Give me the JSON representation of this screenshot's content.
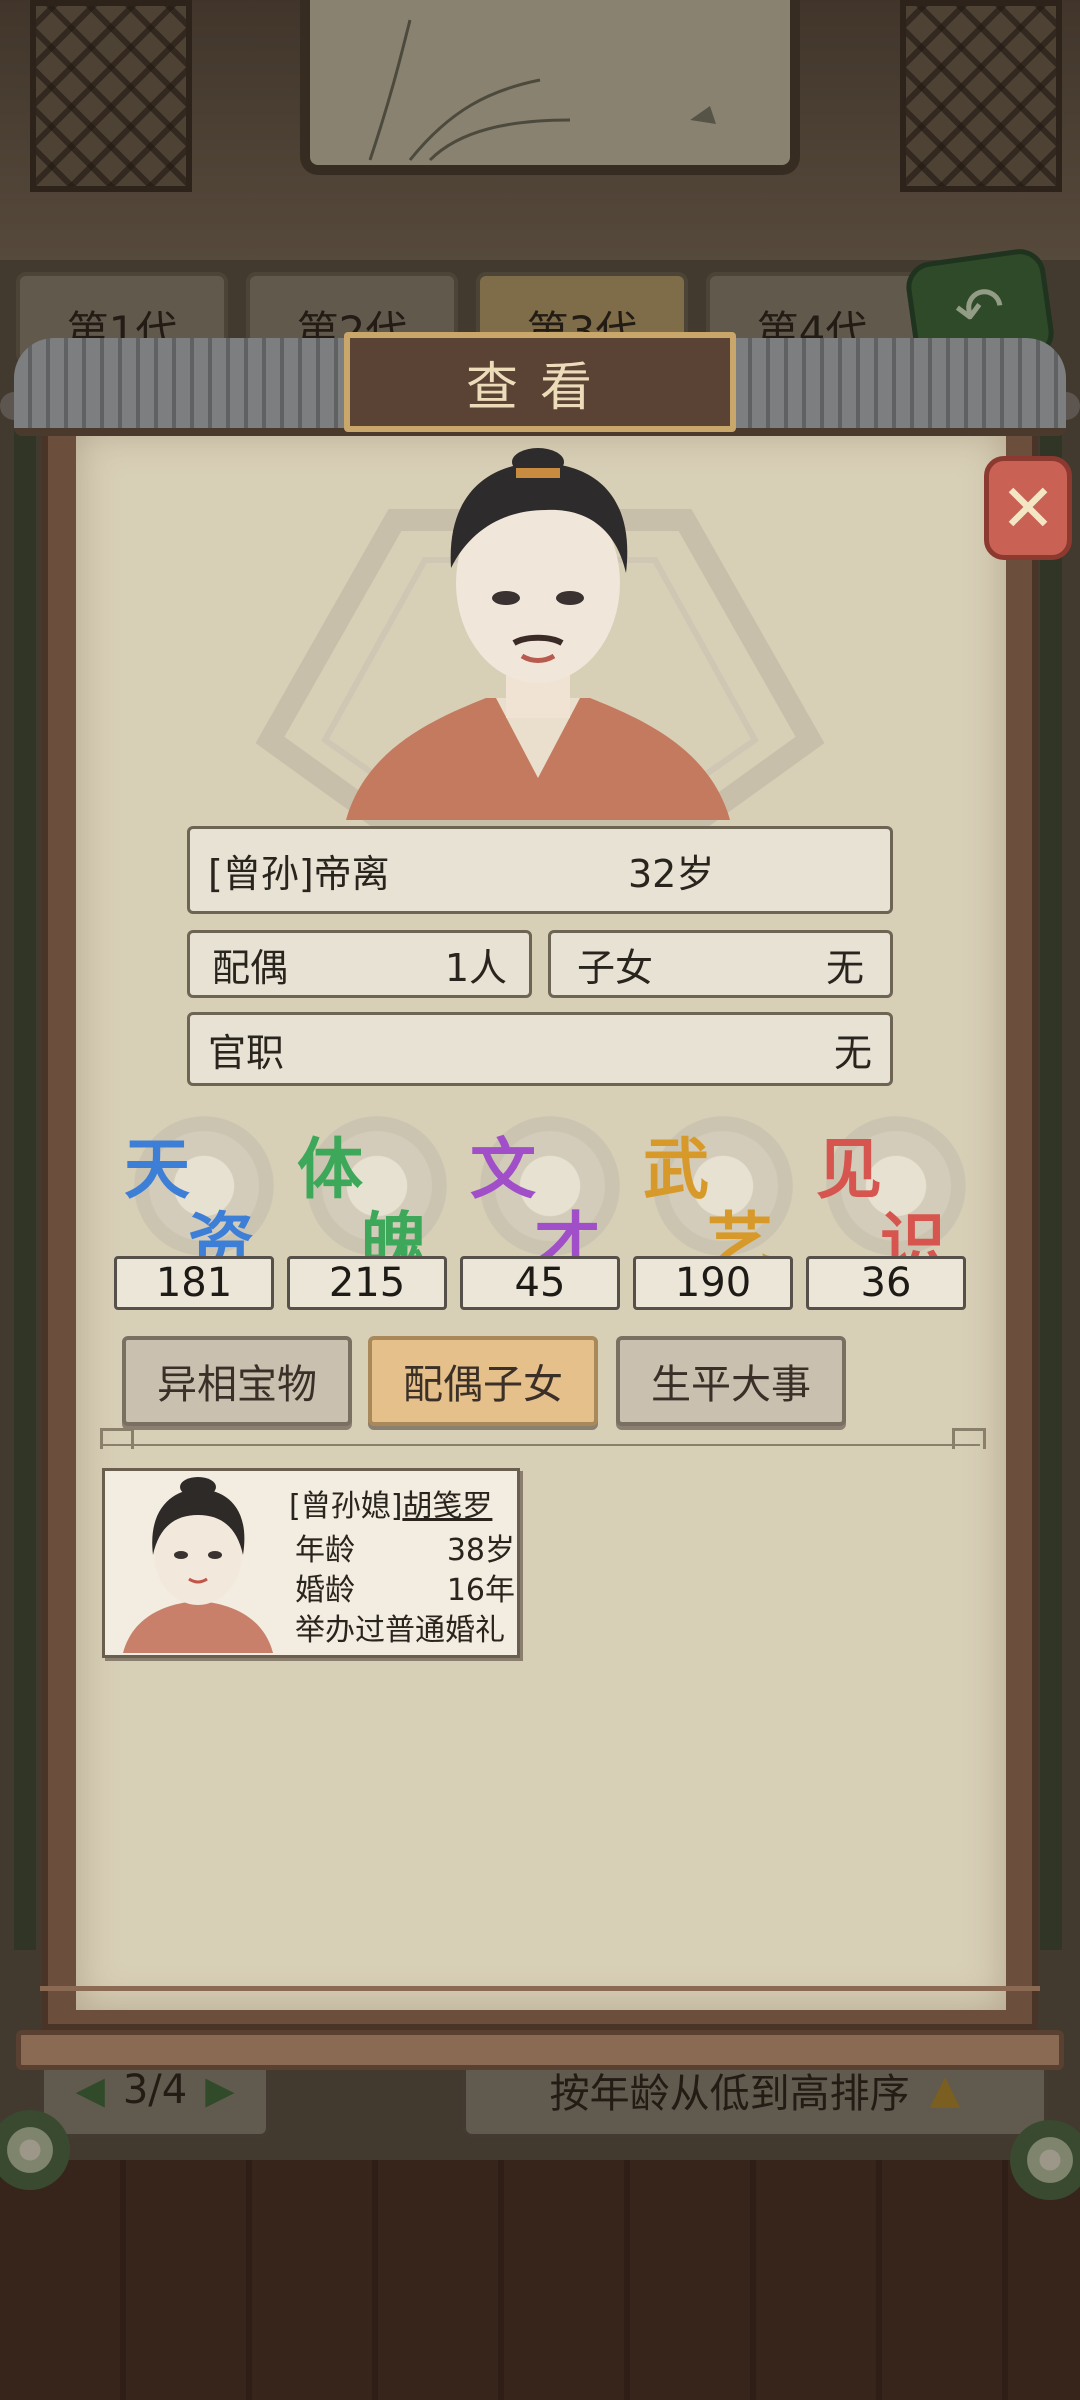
{
  "background": {
    "generation_tabs": [
      "第1代",
      "第2代",
      "第3代",
      "第4代"
    ],
    "active_generation": "第3代",
    "pager": {
      "prev": "◀",
      "value": "3/4",
      "next": "▶"
    },
    "sort_label": "按年龄从低到高排序",
    "sort_icon": "▲"
  },
  "dialog": {
    "title": "查看",
    "close_icon": "close-icon"
  },
  "person": {
    "name": "[曾孙]帝离",
    "age": "32岁",
    "spouse_label": "配偶",
    "spouse_value": "1人",
    "children_label": "子女",
    "children_value": "无",
    "post_label": "官职",
    "post_value": "无"
  },
  "stats": [
    {
      "c1": "天",
      "c2": "资",
      "value": "181",
      "color": "#3d7fd6"
    },
    {
      "c1": "体",
      "c2": "魄",
      "value": "215",
      "color": "#3ea85a"
    },
    {
      "c1": "文",
      "c2": "才",
      "value": "45",
      "color": "#a04fc8"
    },
    {
      "c1": "武",
      "c2": "艺",
      "value": "190",
      "color": "#d79a2a"
    },
    {
      "c1": "见",
      "c2": "识",
      "value": "36",
      "color": "#d6554e"
    }
  ],
  "tabs": {
    "treasures": "异相宝物",
    "spouse_children": "配偶子女",
    "life_events": "生平大事",
    "active": "配偶子女"
  },
  "spouse_card": {
    "prefix": "[曾孙媳]",
    "name": "胡笺罗",
    "age_label": "年龄",
    "age_value": "38岁",
    "marriage_label": "婚龄",
    "marriage_value": "16年",
    "note": "举办过普通婚礼"
  }
}
